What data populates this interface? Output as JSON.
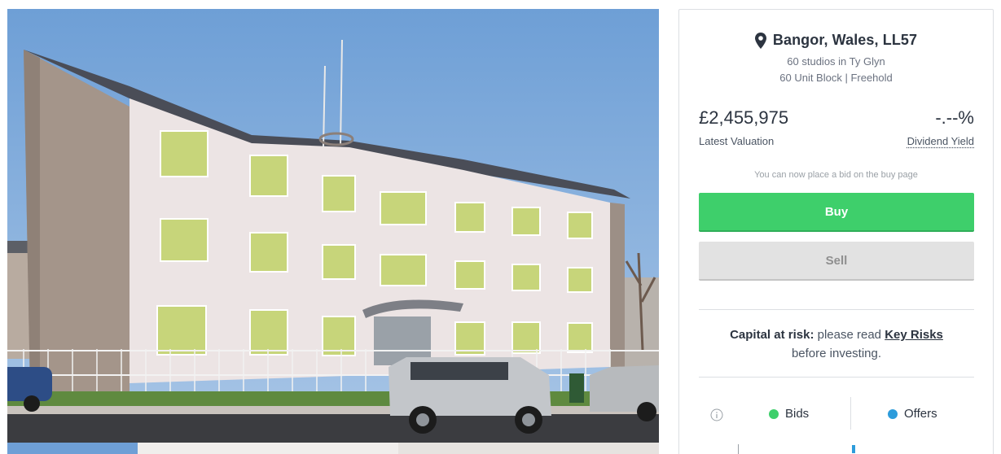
{
  "listing": {
    "location": "Bangor, Wales, LL57",
    "subtitle": "60 studios in Ty Glyn",
    "details": "60 Unit Block | Freehold"
  },
  "valuation": {
    "value": "£2,455,975",
    "label": "Latest Valuation"
  },
  "yield": {
    "value": "-.--%",
    "label": "Dividend Yield"
  },
  "actions": {
    "note": "You can now place a bid on the buy page",
    "buy_label": "Buy",
    "sell_label": "Sell"
  },
  "risk": {
    "prefix": "Capital at risk:",
    "text": " please read ",
    "link": "Key Risks",
    "suffix": " before investing."
  },
  "orderbook": {
    "bids_label": "Bids",
    "offers_label": "Offers",
    "bids_color": "#3ecf6b",
    "offers_color": "#2d9cdb"
  },
  "icons": {
    "location": "map-pin-icon",
    "info": "info-icon"
  }
}
